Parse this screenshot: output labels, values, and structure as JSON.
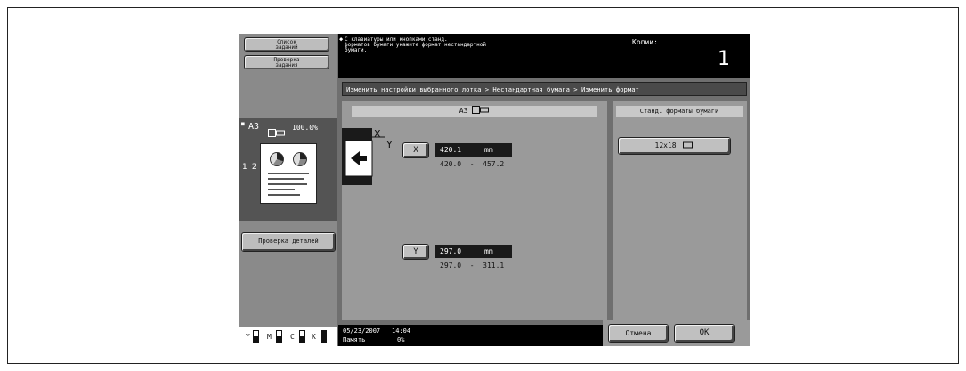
{
  "left_panel": {
    "job_list_label": "Список\nзаданий",
    "job_check_label": "Проверка\nзадания",
    "preview_format": "A3",
    "preview_format_icon": "paper-landscape-icon",
    "preview_zoom": "100.0%",
    "copies_indicator": "1 2",
    "details_label": "Проверка деталей",
    "ink": [
      {
        "label": "Y",
        "level": 0.55
      },
      {
        "label": "M",
        "level": 0.55
      },
      {
        "label": "C",
        "level": 0.55
      },
      {
        "label": "K",
        "level": 1.0
      }
    ]
  },
  "header": {
    "message": "С клавиатуры или кнопками станд.\nформатов бумаги укажите формат нестандартной\nбумаги.",
    "copies_label": "Копии:",
    "copies_value": "1"
  },
  "breadcrumb": "Изменить настройки выбранного лотка > Нестандартная бумага > Изменить формат",
  "main": {
    "format_title": "A3",
    "x_axis_label": "X",
    "y_axis_label": "Y",
    "x_button": "X",
    "x_value": "420.1",
    "x_unit": "mm",
    "x_range": "420.0  -  457.2",
    "y_button": "Y",
    "y_value": "297.0",
    "y_unit": "mm",
    "y_range": "297.0  -  311.1"
  },
  "std_formats": {
    "title": "Станд. форматы бумаги",
    "button_label": "12x18"
  },
  "status_bar": {
    "date": "05/23/2007",
    "time": "14:04",
    "memory_label": "Память",
    "memory_value": "0%"
  },
  "footer": {
    "cancel_label": "Отмена",
    "ok_label": "OK"
  },
  "colors": {
    "screen_bg": "#6f6f6f",
    "button_face": "#c0c0c0",
    "value_bg": "#1a1a1a"
  }
}
